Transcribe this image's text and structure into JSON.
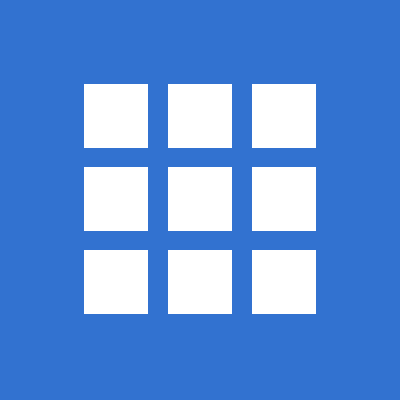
{
  "icon": {
    "name": "app-grid-icon",
    "background_color": "#3272D0",
    "tile_color": "#FFFFFF",
    "grid": {
      "rows": 3,
      "columns": 3
    }
  }
}
